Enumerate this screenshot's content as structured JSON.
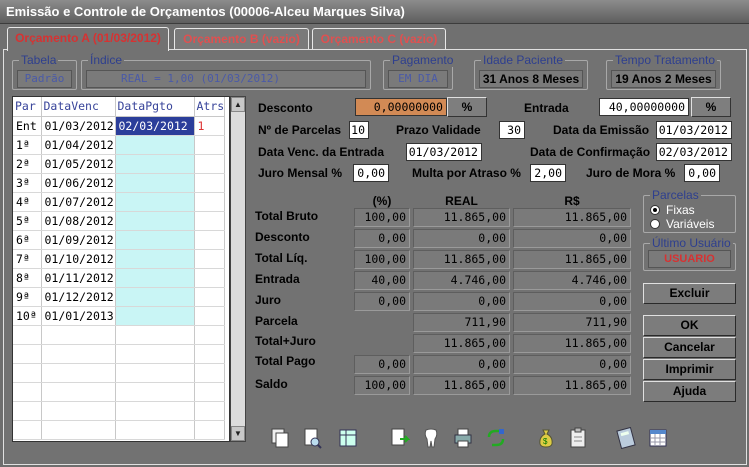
{
  "window": {
    "title": "Emissão e Controle de Orçamentos (00006-Alceu Marques Silva)"
  },
  "tabs": [
    {
      "label": "Orçamento A (01/03/2012)",
      "active": true
    },
    {
      "label": "Orçamento B (vazio)",
      "active": false
    },
    {
      "label": "Orçamento C (vazio)",
      "active": false
    }
  ],
  "groups": {
    "tabela": {
      "title": "Tabela",
      "value": "Padrão"
    },
    "indice": {
      "title": "Índice",
      "value": "REAL = 1,00   (01/03/2012)"
    },
    "pagamento": {
      "title": "Pagamento",
      "value": "EM DIA"
    },
    "idade": {
      "title": "Idade Paciente",
      "value": "31 Anos 8 Meses"
    },
    "tempo": {
      "title": "Tempo Tratamento",
      "value": "19 Anos 2 Meses"
    }
  },
  "installments": {
    "headers": [
      "Par",
      "DataVenc",
      "DataPgto",
      "Atrs"
    ],
    "rows": [
      [
        "Ent",
        "01/03/2012",
        "02/03/2012",
        "1"
      ],
      [
        "1ª",
        "01/04/2012",
        "",
        ""
      ],
      [
        "2ª",
        "01/05/2012",
        "",
        ""
      ],
      [
        "3ª",
        "01/06/2012",
        "",
        ""
      ],
      [
        "4ª",
        "01/07/2012",
        "",
        ""
      ],
      [
        "5ª",
        "01/08/2012",
        "",
        ""
      ],
      [
        "6ª",
        "01/09/2012",
        "",
        ""
      ],
      [
        "7ª",
        "01/10/2012",
        "",
        ""
      ],
      [
        "8ª",
        "01/11/2012",
        "",
        ""
      ],
      [
        "9ª",
        "01/12/2012",
        "",
        ""
      ],
      [
        "10ª",
        "01/01/2013",
        "",
        ""
      ]
    ]
  },
  "form": {
    "desconto_label": "Desconto",
    "desconto_value": "0,00000000",
    "pct_label": "%",
    "entrada_label": "Entrada",
    "entrada_value": "40,00000000",
    "nparcelas_label": "Nº de Parcelas",
    "nparcelas_value": "10",
    "prazo_label": "Prazo Validade",
    "prazo_value": "30",
    "emissao_label": "Data da Emissão",
    "emissao_value": "01/03/2012",
    "venc_entrada_label": "Data Venc. da Entrada",
    "venc_entrada_value": "01/03/2012",
    "confirmacao_label": "Data de Confirmação",
    "confirmacao_value": "02/03/2012",
    "juro_mensal_label": "Juro Mensal %",
    "juro_mensal_value": "0,00",
    "multa_label": "Multa por Atraso %",
    "multa_value": "2,00",
    "juro_mora_label": "Juro de Mora %",
    "juro_mora_value": "0,00"
  },
  "summary": {
    "headers": [
      "(%)",
      "REAL",
      "R$"
    ],
    "rows": [
      {
        "label": "Total Bruto",
        "pct": "100,00",
        "real": "11.865,00",
        "rs": "11.865,00"
      },
      {
        "label": "Desconto",
        "pct": "0,00",
        "real": "0,00",
        "rs": "0,00"
      },
      {
        "label": "Total Líq.",
        "pct": "100,00",
        "real": "11.865,00",
        "rs": "11.865,00"
      },
      {
        "label": "Entrada",
        "pct": "40,00",
        "real": "4.746,00",
        "rs": "4.746,00"
      },
      {
        "label": "Juro",
        "pct": "0,00",
        "real": "0,00",
        "rs": "0,00"
      },
      {
        "label": "Parcela",
        "pct": null,
        "real": "711,90",
        "rs": "711,90"
      },
      {
        "label": "Total+Juro",
        "pct": null,
        "real": "11.865,00",
        "rs": "11.865,00"
      },
      {
        "label": "Total Pago",
        "pct": "0,00",
        "real": "0,00",
        "rs": "0,00"
      },
      {
        "label": "Saldo",
        "pct": "100,00",
        "real": "11.865,00",
        "rs": "11.865,00"
      }
    ]
  },
  "parcelas": {
    "title": "Parcelas",
    "fixas": "Fixas",
    "variaveis": "Variáveis",
    "selected": "fixas"
  },
  "ultimo_usuario": {
    "title": "Último Usuário",
    "value": "USUARIO"
  },
  "buttons": {
    "excluir": "Excluir",
    "ok": "OK",
    "cancelar": "Cancelar",
    "imprimir": "Imprimir",
    "ajuda": "Ajuda"
  },
  "colors": {
    "selected_row": "#2b3e9a",
    "cyan_cell": "#c9f5f5",
    "tab_text": "#d63232",
    "group_title": "#2e3f8f"
  }
}
